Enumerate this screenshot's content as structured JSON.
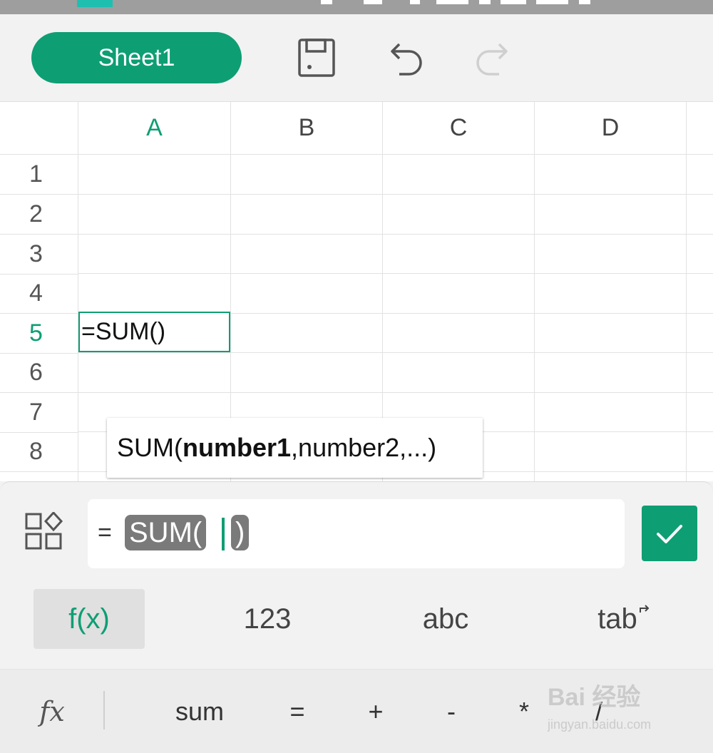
{
  "toolbar": {
    "sheet_tab_label": "Sheet1",
    "save_icon": "save-icon",
    "undo_icon": "undo-icon",
    "redo_icon": "redo-icon"
  },
  "grid": {
    "columns": [
      "A",
      "B",
      "C",
      "D"
    ],
    "rows": [
      "1",
      "2",
      "3",
      "4",
      "5",
      "6",
      "7",
      "8"
    ],
    "active_column": "A",
    "active_row": "5",
    "active_cell_value": "=SUM()"
  },
  "tooltip": {
    "fn_name": "SUM(",
    "arg_current": "number1",
    "arg_rest": ",number2,...)"
  },
  "formula_bar": {
    "equals": "=",
    "token_fn": "SUM(",
    "token_close": ")",
    "apps_icon": "apps-grid-icon",
    "confirm_icon": "checkmark-icon"
  },
  "modes": [
    {
      "label": "f(x)",
      "active": true
    },
    {
      "label": "123",
      "active": false
    },
    {
      "label": "abc",
      "active": false
    },
    {
      "label": "tab",
      "active": false
    }
  ],
  "tab_icon": "tab-arrow-icon",
  "quickbar": {
    "fx_label": "fx",
    "items": [
      "sum",
      "=",
      "+",
      "-",
      "*",
      "/"
    ]
  },
  "watermark": {
    "brand": "Bai 经验",
    "url": "jingyan.baidu.com"
  },
  "colors": {
    "accent": "#0e9e74",
    "token_bg": "#7a7a7a",
    "background": "#f2f2f2"
  }
}
